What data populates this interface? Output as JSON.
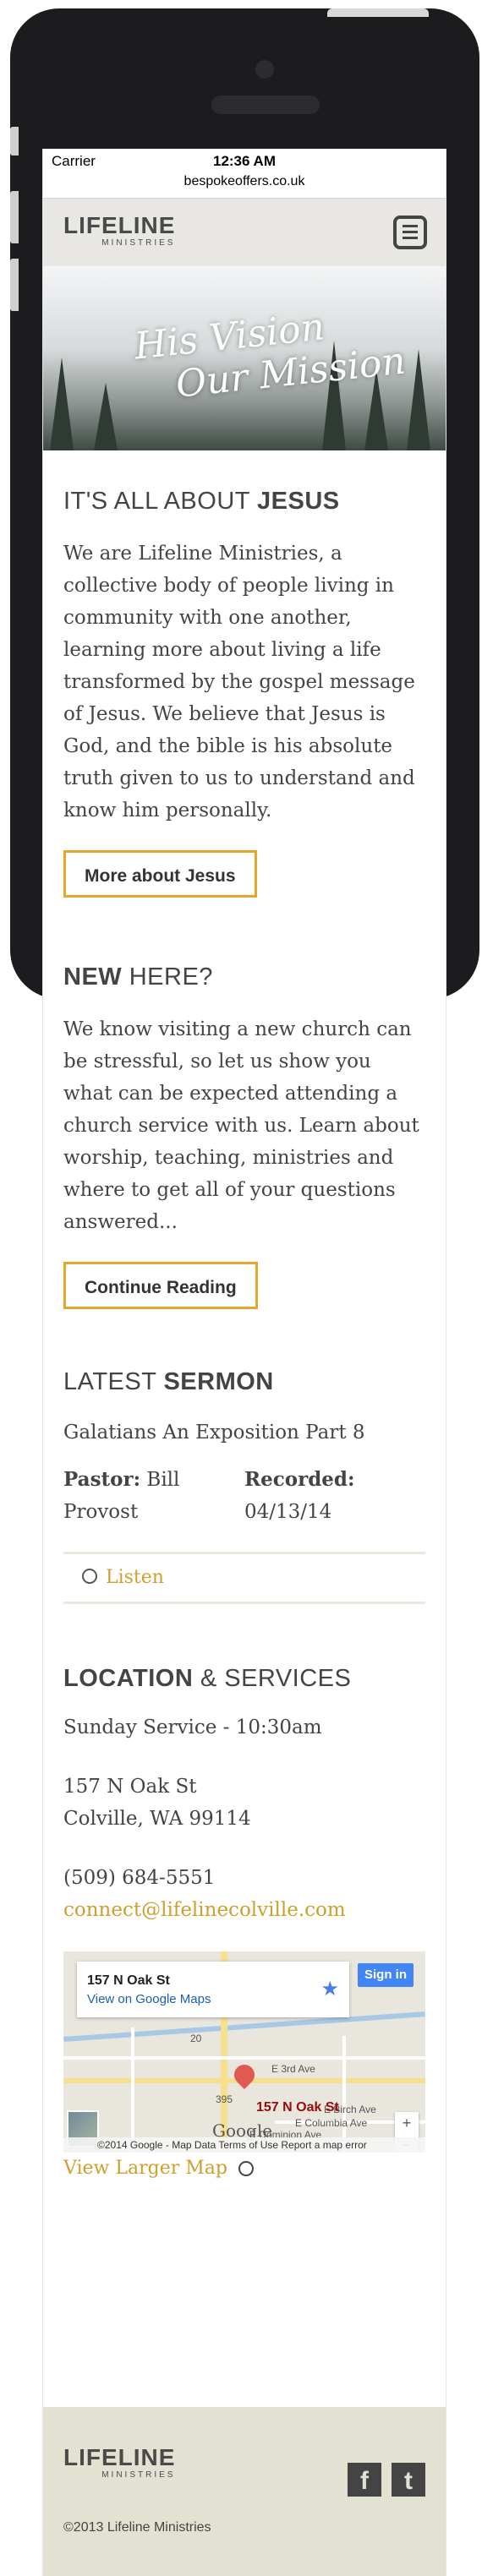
{
  "status_bar": {
    "carrier": "Carrier",
    "time": "12:36 AM"
  },
  "browser": {
    "url": "bespokeoffers.co.uk"
  },
  "header": {
    "logo_word": "LIFELINE",
    "logo_sub": "MINISTRIES",
    "menu_icon": "hamburger-menu-icon"
  },
  "hero": {
    "line1": "His Vision",
    "line2": "Our Mission"
  },
  "about": {
    "title_light": "IT'S ALL ABOUT ",
    "title_bold": "JESUS",
    "body": "We are Lifeline Ministries, a collective body of people living in community with one another, learning more about living a life transformed by the gospel message of Jesus. We believe that Jesus is God, and the bible is his absolute truth given to us to understand and know him personally.",
    "button": "More about Jesus"
  },
  "new_here": {
    "title_bold": "NEW",
    "title_light": " HERE?",
    "body": "We know visiting a new church can be stressful, so let us show you what can be expected attending a church service with us. Learn about worship, teaching, ministries and where to get all of your questions answered...",
    "button": "Continue Reading"
  },
  "sermon": {
    "title_light": "LATEST ",
    "title_bold": "SERMON",
    "name": "Galatians An Exposition Part 8",
    "pastor_label": "Pastor:",
    "pastor_value": " Bill Provost",
    "recorded_label": "Recorded:",
    "recorded_value": "04/13/14",
    "listen": "Listen"
  },
  "location": {
    "title_bold": "LOCATION",
    "title_light": " & SERVICES",
    "service": "Sunday Service - 10:30am",
    "address1": "157 N Oak St",
    "address2": "Colville, WA 99114",
    "phone": "(509) 684-5551",
    "email": "connect@lifelinecolville.com",
    "larger_map": "View Larger Map"
  },
  "map": {
    "card_title": "157 N Oak St",
    "card_link": "View on Google Maps",
    "sign_in": "Sign in",
    "pin_label": "157 N Oak St",
    "streets": [
      "E 3rd Ave",
      "E Birch Ave",
      "E Columbia Ave",
      "E Dominion Ave",
      "395",
      "20"
    ],
    "google": "Google",
    "attribution": "©2014 Google - Map Data   Terms of Use   Report a map error",
    "zoom_in": "+",
    "zoom_out": "−"
  },
  "footer": {
    "logo_word": "LIFELINE",
    "logo_sub": "MINISTRIES",
    "facebook": "f",
    "twitter": "t",
    "copyright": "©2013 Lifeline Ministries"
  }
}
